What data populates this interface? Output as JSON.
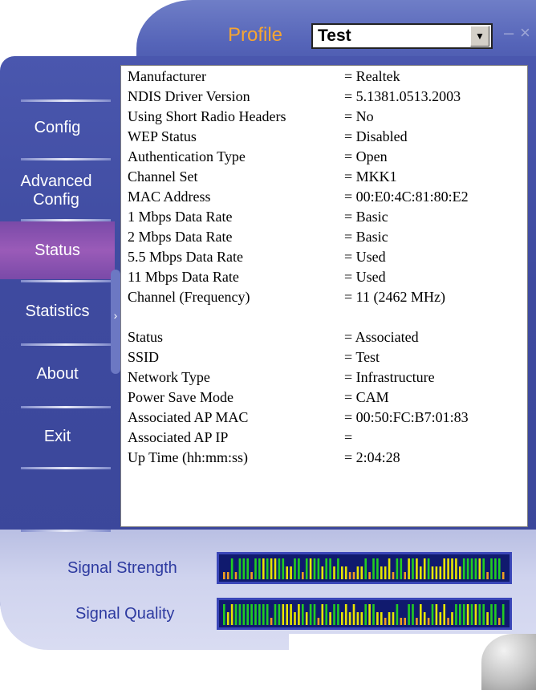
{
  "header": {
    "profile_label": "Profile",
    "profile_value": "Test",
    "dropdown_arrow": "▼",
    "minimize": "–",
    "close": "×"
  },
  "menu": {
    "items": [
      {
        "label": "Config"
      },
      {
        "label": "Advanced Config"
      },
      {
        "label": "Status"
      },
      {
        "label": "Statistics"
      },
      {
        "label": "About"
      },
      {
        "label": "Exit"
      }
    ],
    "active": "Status"
  },
  "status": {
    "rows": [
      {
        "key": "Manufacturer",
        "value": "= Realtek"
      },
      {
        "key": "NDIS Driver Version",
        "value": "= 5.1381.0513.2003"
      },
      {
        "key": "Using Short Radio Headers",
        "value": "= No"
      },
      {
        "key": "WEP Status",
        "value": "= Disabled"
      },
      {
        "key": "Authentication Type",
        "value": "= Open"
      },
      {
        "key": "Channel Set",
        "value": "= MKK1"
      },
      {
        "key": "MAC Address",
        "value": "= 00:E0:4C:81:80:E2"
      },
      {
        "key": "1 Mbps Data Rate",
        "value": "= Basic"
      },
      {
        "key": "2 Mbps Data Rate",
        "value": "= Basic"
      },
      {
        "key": "5.5 Mbps Data Rate",
        "value": "= Used"
      },
      {
        "key": "11 Mbps Data Rate",
        "value": "= Used"
      },
      {
        "key": "Channel (Frequency)",
        "value": "= 11 (2462 MHz)"
      },
      {
        "key": "Status",
        "value": "= Associated"
      },
      {
        "key": "SSID",
        "value": "= Test"
      },
      {
        "key": "Network Type",
        "value": "= Infrastructure"
      },
      {
        "key": "Power Save Mode",
        "value": "= CAM"
      },
      {
        "key": "Associated AP MAC",
        "value": "= 00:50:FC:B7:01:83"
      },
      {
        "key": "Associated AP IP",
        "value": "="
      },
      {
        "key": "Up Time (hh:mm:ss)",
        "value": "= 2:04:28"
      }
    ]
  },
  "signal": {
    "strength_label": "Signal Strength",
    "quality_label": "Signal Quality",
    "colors": {
      "high": "#22cc22",
      "mid": "#e6e600",
      "low": "#f0a020",
      "bg": "#101a6e"
    }
  },
  "skin_colors": {
    "panel_blue": "#3e4a9f",
    "profile_orange": "#f7a531",
    "label_blue": "#2d3aa0",
    "active_purple": "#8a52b0"
  }
}
